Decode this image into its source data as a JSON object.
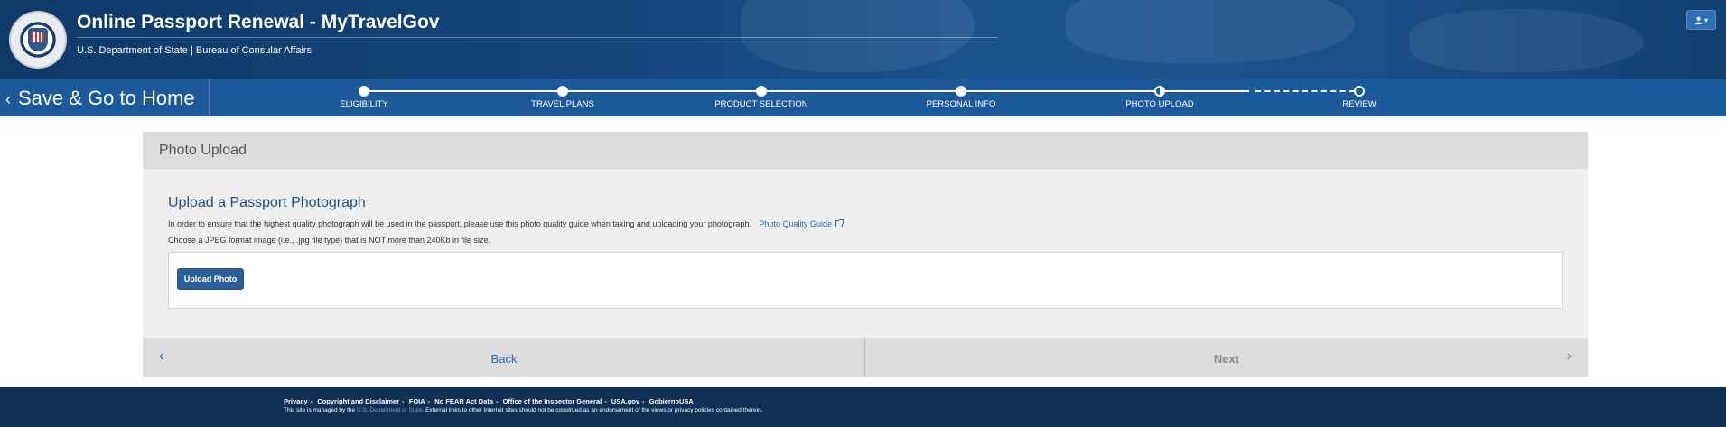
{
  "header": {
    "title": "Online Passport Renewal - MyTravelGov",
    "subtitle": "U.S. Department of State | Bureau of Consular Affairs",
    "user_menu_caret": "▾"
  },
  "progress": {
    "save_home_label": "Save & Go to Home",
    "save_home_chevron": "‹",
    "steps": [
      {
        "label": "ELIGIBILITY",
        "state": "complete"
      },
      {
        "label": "TRAVEL PLANS",
        "state": "complete"
      },
      {
        "label": "PRODUCT SELECTION",
        "state": "complete"
      },
      {
        "label": "PERSONAL INFO",
        "state": "complete"
      },
      {
        "label": "PHOTO UPLOAD",
        "state": "current"
      },
      {
        "label": "REVIEW",
        "state": "pending"
      }
    ]
  },
  "card": {
    "header": "Photo Upload",
    "section_title": "Upload a Passport Photograph",
    "description": "In order to ensure that the highest quality photograph will be used in the passport, please use this photo quality guide when taking and uploading your photograph.",
    "guide_link": "Photo Quality Guide",
    "format_note": "Choose a JPEG format image (i.e., .jpg file type) that is NOT more than 240Kb in file size.",
    "upload_button": "Upload Photo",
    "back_label": "Back",
    "next_label": "Next",
    "back_chevron": "‹",
    "next_chevron": "›"
  },
  "footer": {
    "links": [
      "Privacy",
      "Copyright and Disclaimer",
      "FOIA",
      "No FEAR Act Data",
      "Office of the Inspector General",
      "USA.gov",
      "GobiernoUSA"
    ],
    "separator": "-",
    "note_prefix": "This site is managed by the",
    "note_dos": "U.S. Department of State",
    "note_suffix": ". External links to other Internet sites should not be construed as an endorsement of the views or privacy policies contained therein."
  },
  "colors": {
    "header_bg": "#14457b",
    "progress_bg": "#1d5a9c",
    "accent_blue": "#2a6cb3",
    "button_bg": "#2c5f97",
    "footer_bg": "#0f2f55"
  }
}
